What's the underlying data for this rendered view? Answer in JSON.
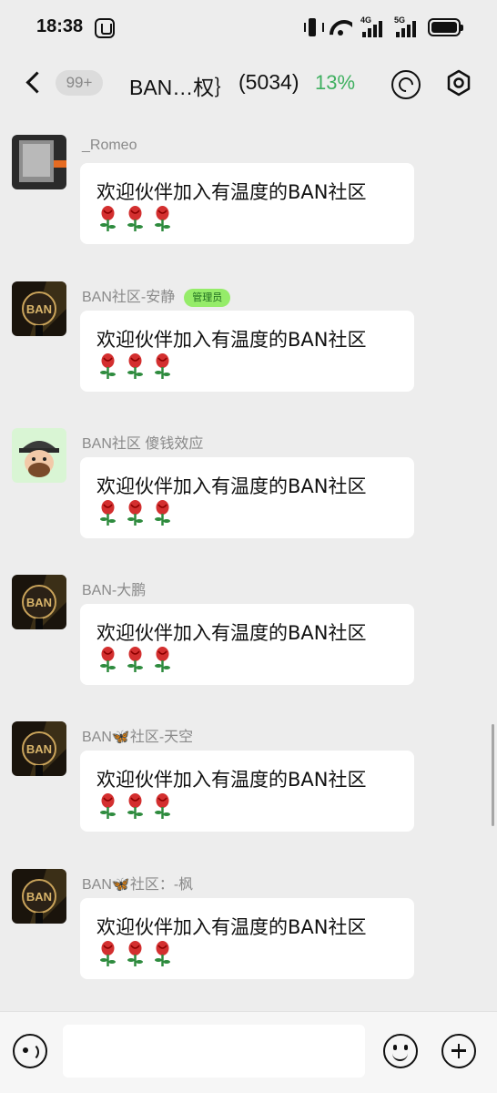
{
  "status_bar": {
    "time": "18:38",
    "signal_1_label": "4G",
    "signal_2_label": "5G",
    "icons": [
      "hand-icon",
      "vibrate-icon",
      "wifi-icon",
      "signal-4g-icon",
      "signal-5g-icon",
      "battery-icon"
    ]
  },
  "header": {
    "unread_count": "99+",
    "title": "BAN…权｝",
    "member_count": "(5034)",
    "extra": "13%",
    "icons": [
      "back-icon",
      "refresh-icon",
      "settings-icon"
    ]
  },
  "messages": [
    {
      "sender": "_Romeo",
      "badge": "",
      "text": "欢迎伙伴加入有温度的BAN社区",
      "emoji_count": 3,
      "avatar": "photo-dark"
    },
    {
      "sender": "BAN社区-安静",
      "badge": "管理员",
      "text": "欢迎伙伴加入有温度的BAN社区",
      "emoji_count": 3,
      "avatar": "ban-logo"
    },
    {
      "sender": "BAN社区 傻钱效应",
      "badge": "",
      "text": "欢迎伙伴加入有温度的BAN社区",
      "emoji_count": 3,
      "avatar": "cartoon-pirate"
    },
    {
      "sender": "BAN-大鹏",
      "badge": "",
      "text": "欢迎伙伴加入有温度的BAN社区",
      "emoji_count": 3,
      "avatar": "ban-logo"
    },
    {
      "sender": "BAN🦋社区-天空",
      "badge": "",
      "text": "欢迎伙伴加入有温度的BAN社区",
      "emoji_count": 3,
      "avatar": "ban-logo"
    },
    {
      "sender": "BAN🦋社区：-枫",
      "badge": "",
      "text": "欢迎伙伴加入有温度的BAN社区",
      "emoji_count": 3,
      "avatar": "ban-logo"
    }
  ],
  "input_bar": {
    "placeholder": "",
    "icons": [
      "voice-icon",
      "emoji-icon",
      "add-icon"
    ]
  },
  "colors": {
    "background": "#ededed",
    "bubble": "#ffffff",
    "count_accent": "#3fb060",
    "admin_badge_bg": "#95ec69"
  }
}
